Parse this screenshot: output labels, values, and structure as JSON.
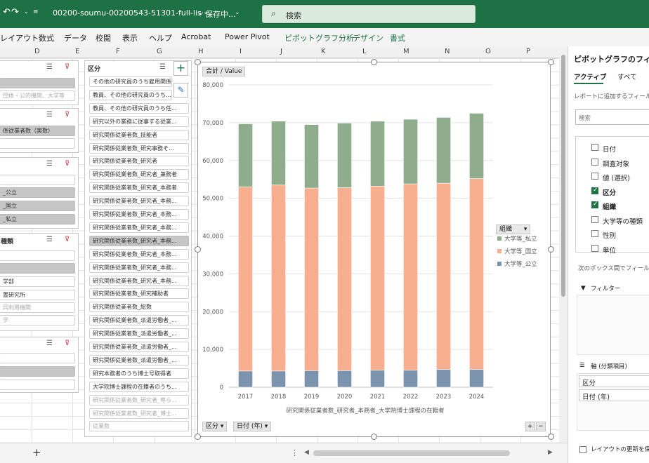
{
  "titlebar": {
    "filename": "00200-soumu-00200543-51301-full-lis···",
    "save_state": "• 保存中...",
    "search_placeholder": "検索"
  },
  "menu": {
    "items": [
      "レイアウト",
      "数式",
      "データ",
      "校閲",
      "表示",
      "ヘルプ",
      "Acrobat",
      "Power Pivot"
    ],
    "context_items": [
      "ピボットグラフ分析",
      "デザイン",
      "書式"
    ]
  },
  "columns": [
    "D",
    "E",
    "F",
    "G",
    "H",
    "I",
    "J",
    "K",
    "L",
    "M",
    "N",
    "O",
    "P"
  ],
  "slicers_left": [
    {
      "items": [
        "",
        "団体・公的機関、大学等"
      ]
    },
    {
      "items": [
        "係従業者数（実数）",
        ""
      ]
    },
    {
      "items": [
        "",
        "_公立",
        "_国立",
        "_私立"
      ]
    },
    {
      "header": "種類",
      "items": [
        "",
        "",
        "学部",
        "置研究所",
        "同利用機関",
        "学"
      ]
    },
    {
      "items": [
        "",
        "",
        ""
      ]
    }
  ],
  "kubun": {
    "header": "区分",
    "items": [
      "その他の研究員のうち雇用関係...",
      "教員、その他の研究員のうち...",
      "教員、その他の研究員のうち任...",
      "研究以外の業務に従事する従業...",
      "研究関係従業者数_技能者",
      "研究関係従業者数_研究事務そ...",
      "研究関係従業者数_研究者",
      "研究関係従業者数_研究者_兼務者",
      "研究関係従業者数_研究者_本務者",
      "研究関係従業者数_研究者_本務...",
      "研究関係従業者数_研究者_本務...",
      "研究関係従業者数_研究者_本務...",
      "研究関係従業者数_研究者_本務...",
      "研究関係従業者数_研究者_本務...",
      "研究関係従業者数_研究者_本務...",
      "研究関係従業者数_研究者_本務...",
      "研究関係従業者数_研究補助者",
      "研究関係従業者数_総数",
      "研究関係従業者数_派遣労働者_...",
      "研究関係従業者数_派遣労働者_...",
      "研究関係従業者数_派遣労働者_...",
      "研究関係従業者数_派遣労働者_...",
      "研究本務者のうち博士号取得者",
      "大学院博士課程の在籍者のうち...",
      "研究関係従業者数_研究者_専ら...",
      "研究関係従業者数_研究者_博士...",
      "従業数"
    ]
  },
  "chart_data": {
    "type": "bar",
    "stacked": true,
    "value_label": "合計 / Value",
    "categories": [
      "2017",
      "2018",
      "2019",
      "2020",
      "2021",
      "2022",
      "2023",
      "2024"
    ],
    "series": [
      {
        "name": "大学等_公立",
        "color": "#7b93ad",
        "values": [
          4300,
          4300,
          4400,
          4400,
          4500,
          4500,
          4700,
          4700
        ]
      },
      {
        "name": "大学等_国立",
        "color": "#f7ae8e",
        "values": [
          48700,
          49200,
          48300,
          48400,
          48700,
          49300,
          49300,
          50500
        ]
      },
      {
        "name": "大学等_私立",
        "color": "#8fad8d",
        "values": [
          16700,
          16900,
          16800,
          17100,
          17200,
          17100,
          17400,
          17300
        ]
      }
    ],
    "ylim": [
      0,
      80000
    ],
    "yticks": [
      "0",
      "10,000",
      "20,000",
      "30,000",
      "40,000",
      "50,000",
      "60,000",
      "70,000",
      "80,000"
    ],
    "xlabel": "研究関係従業者数_研究者_本務者_大学院博士課程の在籍者",
    "legend_title": "組織",
    "legend_items": [
      "大学等_私立",
      "大学等_国立",
      "大学等_公立"
    ],
    "legend_position": "right",
    "axis_fields": [
      "区分",
      "日付 (年)"
    ]
  },
  "pane": {
    "title": "ピボットグラフのフィール",
    "tabs": [
      "アクティブ",
      "すべて"
    ],
    "subtitle": "レポートに追加するフィール",
    "search_placeholder": "検索",
    "fields": [
      {
        "label": "日付",
        "checked": false
      },
      {
        "label": "調査対象",
        "checked": false
      },
      {
        "label": "値 (選択)",
        "checked": false
      },
      {
        "label": "区分",
        "checked": true
      },
      {
        "label": "組織",
        "checked": true
      },
      {
        "label": "大学等の種類",
        "checked": false
      },
      {
        "label": "性別",
        "checked": false
      },
      {
        "label": "単位",
        "checked": false
      }
    ],
    "drag_hint": "次のボックス間でフィールドを",
    "filters_label": "フィルター",
    "axis_label": "軸 (分類項目)",
    "axis_items": [
      "区分",
      "日付 (年)"
    ],
    "defer_label": "レイアウトの更新を保留"
  },
  "statusbar": {
    "add_sheet": "+"
  }
}
